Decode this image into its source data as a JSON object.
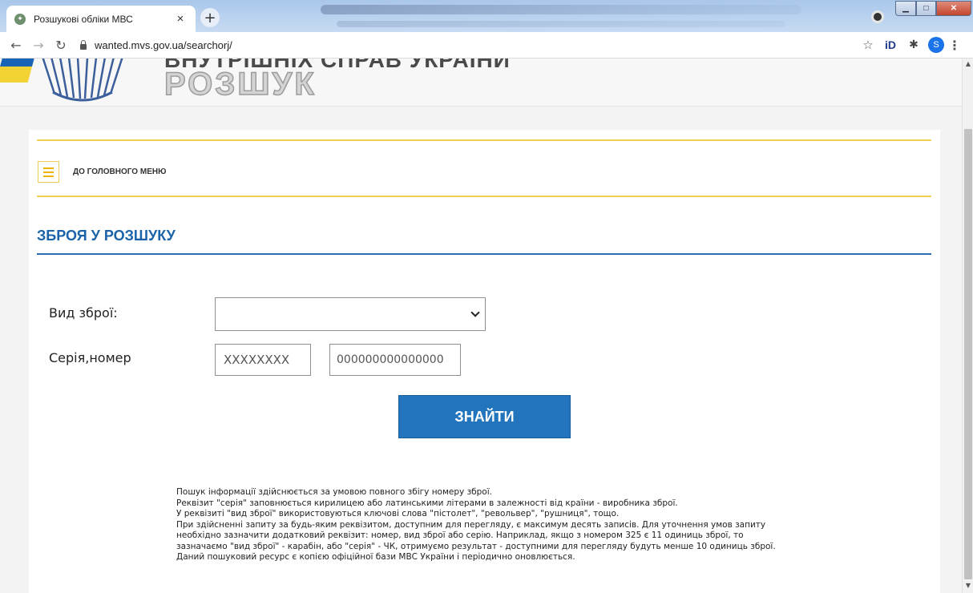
{
  "browser": {
    "tab_title": "Розшукові обліки МВС",
    "tab_close": "×",
    "new_tab": "+",
    "url": "wanted.mvs.gov.ua/searchorj/",
    "avatar_letter": "S",
    "ext_label": "iD",
    "icons": {
      "back": "arrow-left-icon",
      "forward": "arrow-right-icon",
      "reload": "reload-icon",
      "lock": "lock-icon",
      "star": "star-icon",
      "extensions": "puzzle-icon",
      "menu": "more-vert-icon"
    }
  },
  "header": {
    "top_text": "ВНУТРІШНІХ СПРАВ УКРАЇНИ",
    "logo_text": "РОЗШУК"
  },
  "nav": {
    "main_menu_label": "ДО ГОЛОВНОГО МЕНЮ"
  },
  "page": {
    "section_title": "ЗБРОЯ У РОЗШУКУ",
    "form": {
      "weapon_type_label": "Вид зброї:",
      "weapon_type_value": "",
      "serial_label": "Серія,номер",
      "series_placeholder": "XXXXXXXX",
      "number_placeholder": "000000000000000",
      "search_button": "ЗНАЙТИ"
    },
    "info_lines": [
      "Пошук інформації здійснюється за умовою повного збігу номеру зброї.",
      "Реквізит \"серія\" заповнюється кирилицею або латинськими літерами в залежності від країни - виробника зброї.",
      "У реквізиті \"вид зброї\" використовуються ключові слова \"пістолет\", \"револьвер\", \"рушниця\", тощо.",
      "При здійсненні запиту за будь-яким реквізитом, доступним для перегляду, є максимум десять записів. Для уточнення умов запиту необхідно зазначити додатковий реквізит: номер, вид зброї або серію. Наприклад, якщо з номером 325 є 11 одиниць зброї, то зазначаємо \"вид зброї\" - карабін, або \"серія\" - ЧК, отримуємо результат - доступними для перегляду будуть менше 10 одиниць зброї.",
      "Даний пошуковий ресурс є копією офіційної бази МВС України і періодично оновлюється."
    ]
  },
  "colors": {
    "accent_blue": "#2275bd",
    "title_blue": "#1b63a9",
    "rule_yellow": "#f1cf52"
  }
}
